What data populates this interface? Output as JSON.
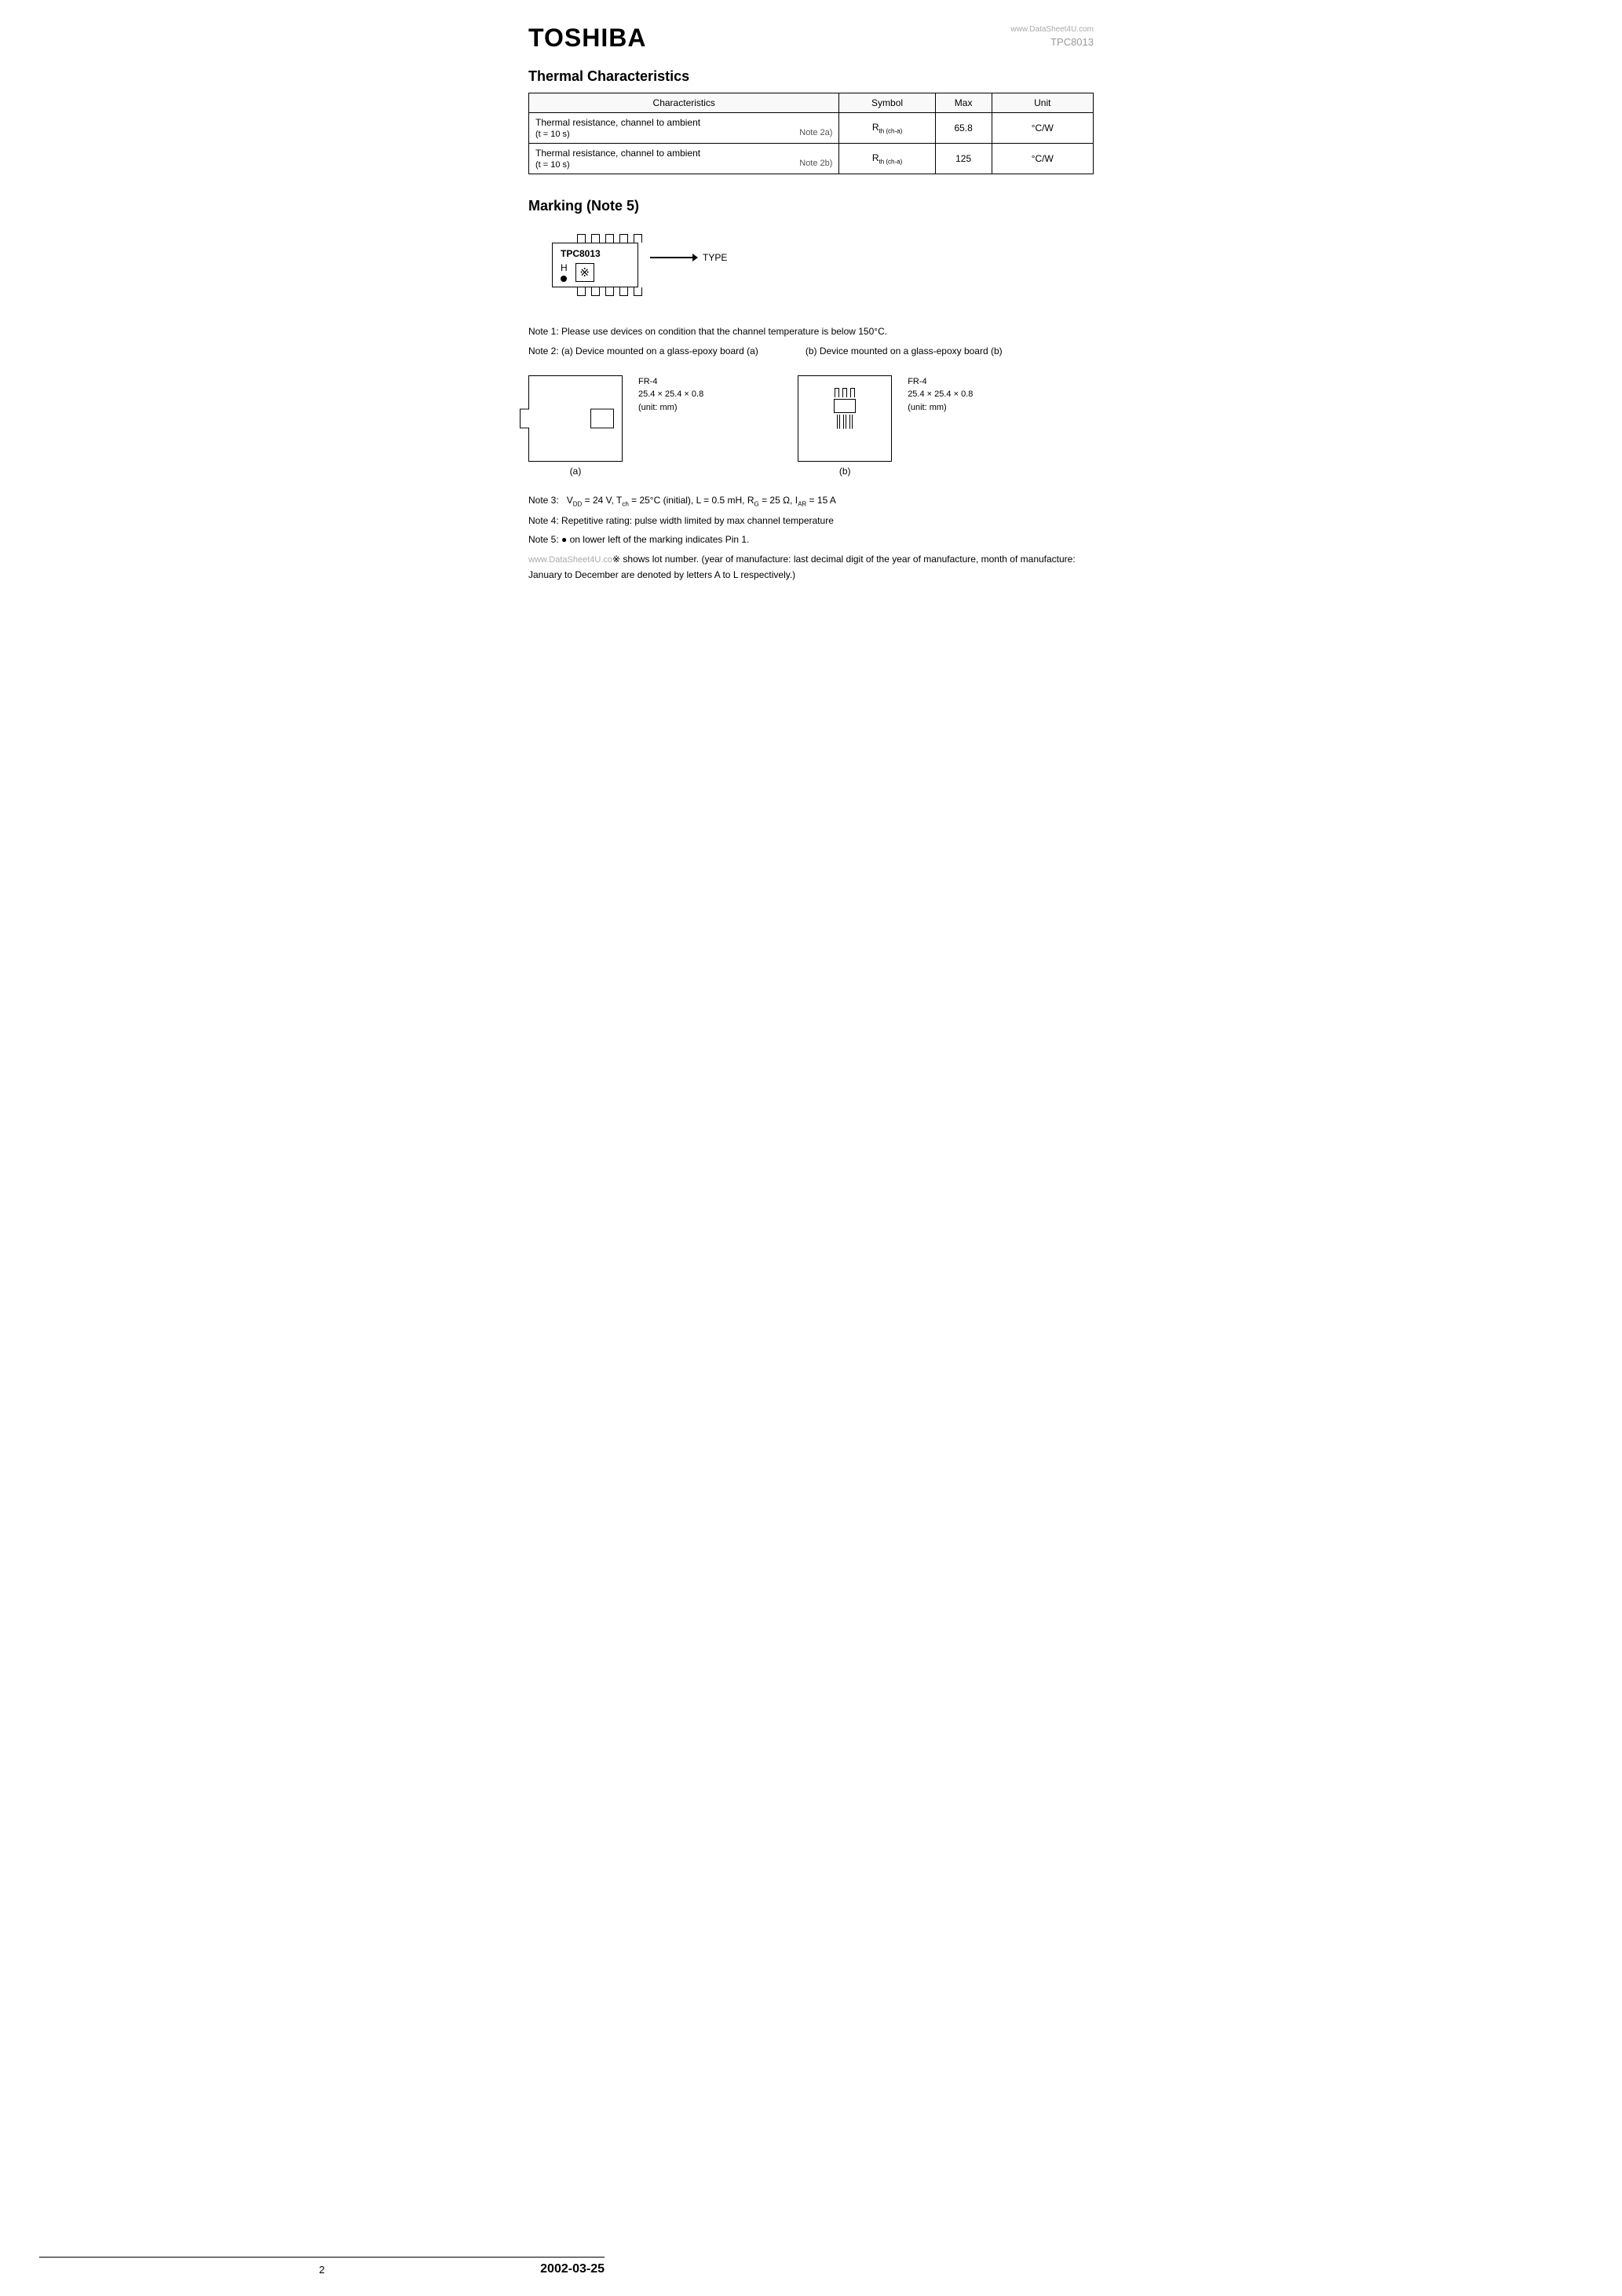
{
  "header": {
    "logo": "TOSHIBA",
    "watermark": "www.DataSheet4U.com",
    "part_number": "TPC8013"
  },
  "thermal_section": {
    "title": "Thermal Characteristics",
    "table": {
      "headers": [
        "Characteristics",
        "Symbol",
        "Max",
        "Unit"
      ],
      "rows": [
        {
          "char_line1": "Thermal resistance, channel to ambient",
          "char_line2": "(t = 10 s)",
          "char_note": "Note 2a)",
          "symbol": "Rth (ch-a)",
          "max": "65.8",
          "unit": "°C/W"
        },
        {
          "char_line1": "Thermal resistance, channel to ambient",
          "char_line2": "(t = 10 s)",
          "char_note": "Note 2b)",
          "symbol": "Rth (ch-a)",
          "max": "125",
          "unit": "°C/W"
        }
      ]
    }
  },
  "marking_section": {
    "title": "Marking (Note 5)",
    "ic_label": "TPC8013",
    "row_label": "H",
    "type_label": "TYPE",
    "dot_note": "●",
    "x_symbol": "※"
  },
  "notes": {
    "note1": "Note 1:  Please use devices on condition that the channel temperature is below 150°C.",
    "note2a_label": "Note 2:  (a) Device mounted on a glass-epoxy board (a)",
    "note2b_label": "(b) Device mounted on a glass-epoxy board (b)",
    "board_a": {
      "fr": "FR-4",
      "dimensions": "25.4 × 25.4 × 0.8",
      "unit": "(unit: mm)",
      "label": "(a)"
    },
    "board_b": {
      "fr": "FR-4",
      "dimensions": "25.4 × 25.4 × 0.8",
      "unit": "(unit: mm)",
      "label": "(b)"
    },
    "note3": "Note 3:   Vᴵᴵ = 24 V, Tᶜʰ = 25°C (initial), L = 0.5 mH, Rᴳ = 25 Ω, Iᴬᴵ = 15 A",
    "note3_raw": "Note 3:  VDD = 24 V, Tch = 25°C (initial), L = 0.5 mH, RG = 25 Ω, IAR = 15 A",
    "note4": "Note 4:  Repetitive rating: pulse width limited by max channel temperature",
    "note5": "Note 5:  ● on lower left of the marking indicates Pin 1.",
    "note6_prefix": "www.DataSheet4U.co",
    "note6_symbol": "※",
    "note6_text": " shows lot number. (year of manufacture: last decimal digit of the year of manufacture, month of manufacture: January to December are denoted by letters A to L respectively.)"
  },
  "footer": {
    "page": "2",
    "date": "2002-03-25"
  }
}
